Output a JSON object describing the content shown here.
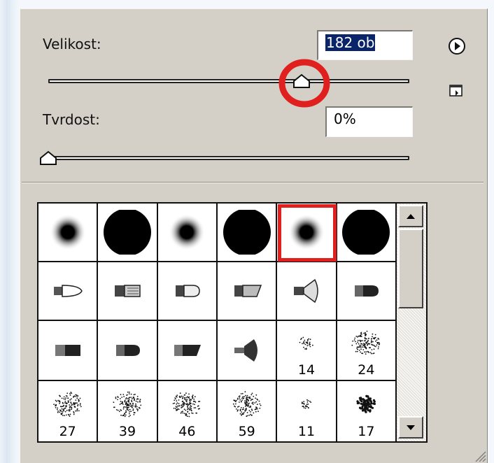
{
  "panel": {
    "size_label": "Velikost:",
    "size_value": "182 ob",
    "size_slider_fraction": 0.71,
    "hardness_label": "Tvrdost:",
    "hardness_value": "0%",
    "hardness_slider_fraction": 0.0,
    "menu_icon": "play-circle-icon",
    "new_preset_icon": "new-page-icon",
    "highlight_color": "#e0201e"
  },
  "brushes": [
    {
      "type": "soft-round",
      "label": ""
    },
    {
      "type": "hard-round",
      "label": ""
    },
    {
      "type": "soft-round",
      "label": ""
    },
    {
      "type": "hard-round",
      "label": ""
    },
    {
      "type": "soft-round",
      "label": "",
      "selected": true
    },
    {
      "type": "hard-round",
      "label": ""
    },
    {
      "type": "tip-round",
      "label": ""
    },
    {
      "type": "flat-bristle",
      "label": ""
    },
    {
      "type": "bullet",
      "label": ""
    },
    {
      "type": "angled-bristle",
      "label": ""
    },
    {
      "type": "fan",
      "label": ""
    },
    {
      "type": "bullet-dark",
      "label": ""
    },
    {
      "type": "flat-dark",
      "label": ""
    },
    {
      "type": "bullet-dark",
      "label": ""
    },
    {
      "type": "angled-dark",
      "label": ""
    },
    {
      "type": "fan-dark",
      "label": ""
    },
    {
      "type": "spatter-small",
      "label": "14"
    },
    {
      "type": "spatter-medium",
      "label": "24"
    },
    {
      "type": "spatter",
      "label": "27"
    },
    {
      "type": "spatter",
      "label": "39"
    },
    {
      "type": "spatter",
      "label": "46"
    },
    {
      "type": "spatter-light",
      "label": "59"
    },
    {
      "type": "spatter-tiny",
      "label": "11"
    },
    {
      "type": "spatter-dense",
      "label": "17"
    }
  ],
  "scrollbar": {
    "up_icon": "arrow-up-icon",
    "down_icon": "arrow-down-icon"
  }
}
